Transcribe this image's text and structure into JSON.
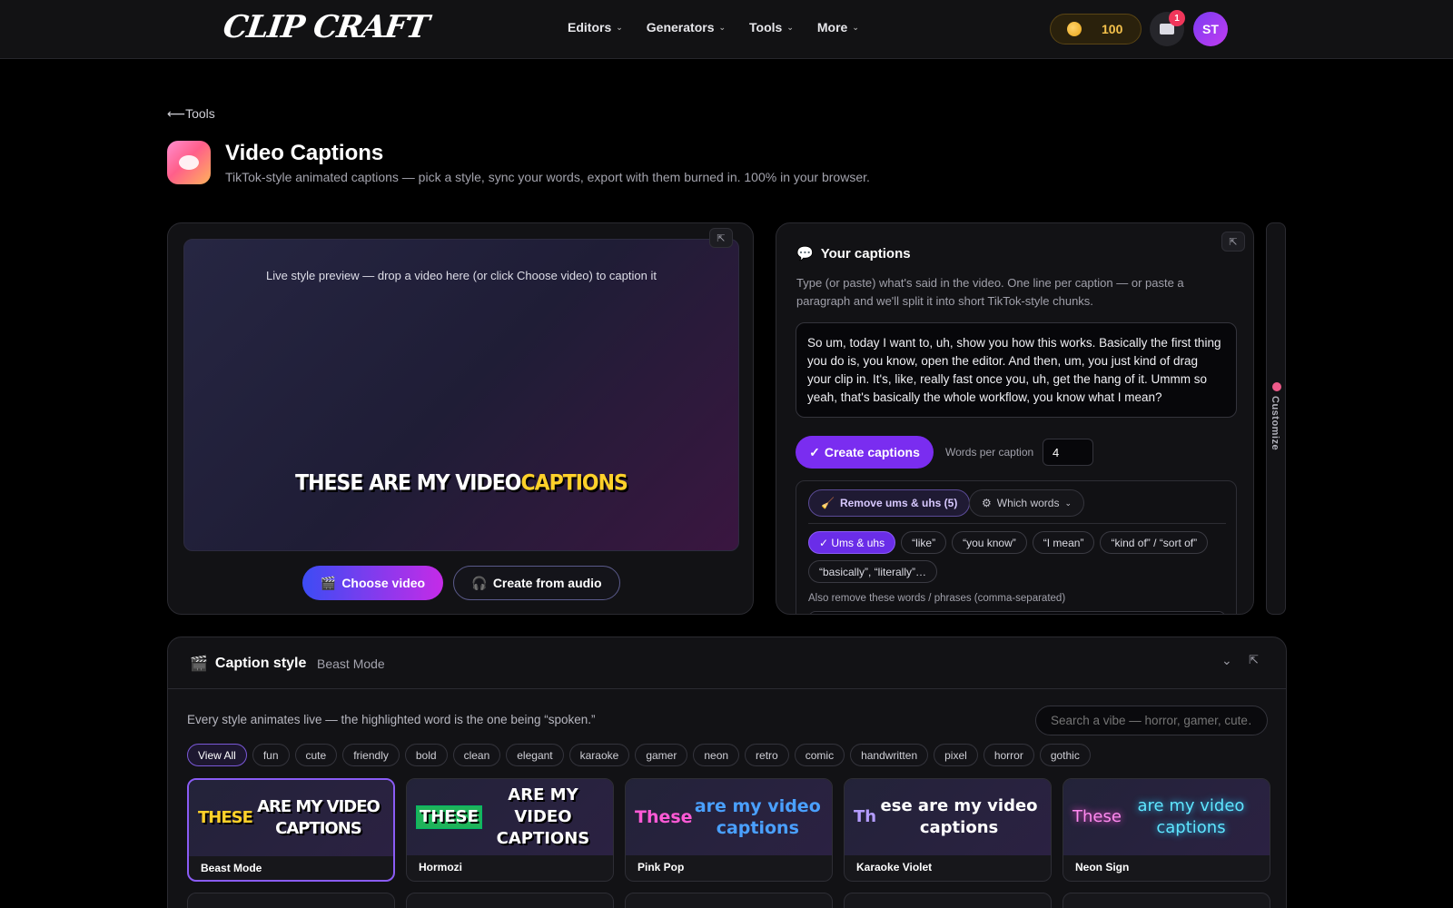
{
  "header": {
    "logo": "CLIP CRAFT",
    "nav": [
      {
        "label": "Editors"
      },
      {
        "label": "Generators"
      },
      {
        "label": "Tools"
      },
      {
        "label": "More"
      }
    ],
    "coins": "100",
    "inbox_badge": "1",
    "avatar_initials": "ST"
  },
  "page": {
    "back_label": "Tools",
    "title": "Video Captions",
    "subtitle": "TikTok-style animated captions — pick a style, sync your words, export with them burned in. 100% in your browser."
  },
  "preview": {
    "hint": "Live style preview — drop a video here (or click Choose video) to caption it",
    "caption_text": "THESE ARE MY VIDEO",
    "caption_highlight": "CAPTIONS",
    "choose_label": "Choose video",
    "audio_label": "Create from audio"
  },
  "captions": {
    "title": "Your captions",
    "description": "Type (or paste) what's said in the video. One line per caption — or paste a paragraph and we'll split it into short TikTok-style chunks.",
    "text": "So um, today I want to, uh, show you how this works. Basically the first thing you do is, you know, open the editor. And then, um, you just kind of drag your clip in. It's, like, really fast once you, uh, get the hang of it. Ummm so yeah, that's basically the whole workflow, you know what I mean?",
    "create_label": "Create captions",
    "words_per_caption_label": "Words per caption",
    "words_per_caption": "4",
    "remove_label": "Remove ums & uhs (5)",
    "which_words_label": "Which words",
    "chips": [
      {
        "label": "✓ Ums & uhs",
        "active": true
      },
      {
        "label": "“like”",
        "active": false
      },
      {
        "label": "“you know”",
        "active": false
      },
      {
        "label": "“I mean”",
        "active": false
      },
      {
        "label": "“kind of” / “sort of”",
        "active": false
      },
      {
        "label": "“basically”, “literally”…",
        "active": false
      }
    ],
    "also_remove_label": "Also remove these words / phrases (comma-separated)"
  },
  "side_tab": {
    "label": "Customize"
  },
  "caption_style": {
    "title": "Caption style",
    "current": "Beast Mode",
    "description": "Every style animates live — the highlighted word is the one being “spoken.”",
    "search_placeholder": "Search a vibe — horror, gamer, cute…",
    "tags": [
      "View All",
      "fun",
      "cute",
      "friendly",
      "bold",
      "clean",
      "elegant",
      "karaoke",
      "gamer",
      "neon",
      "retro",
      "comic",
      "handwritten",
      "pixel",
      "horror",
      "gothic"
    ],
    "active_tag": "View All",
    "styles": [
      {
        "name": "Beast Mode",
        "hl": "THESE",
        "rest": " ARE MY VIDEO CAPTIONS",
        "cls": "cp-beast",
        "selected": true
      },
      {
        "name": "Hormozi",
        "hl": "THESE",
        "rest": " ARE MY VIDEO CAPTIONS",
        "cls": "cp-hormozi",
        "selected": false
      },
      {
        "name": "Pink Pop",
        "hl": "These",
        "rest": " are my video captions",
        "cls": "cp-pink",
        "selected": false
      },
      {
        "name": "Karaoke Violet",
        "hl": "Th",
        "rest": "ese are my video captions",
        "cls": "cp-karaoke",
        "selected": false
      },
      {
        "name": "Neon Sign",
        "hl": "These",
        "rest": " are my video captions",
        "cls": "cp-neon",
        "selected": false
      }
    ]
  }
}
